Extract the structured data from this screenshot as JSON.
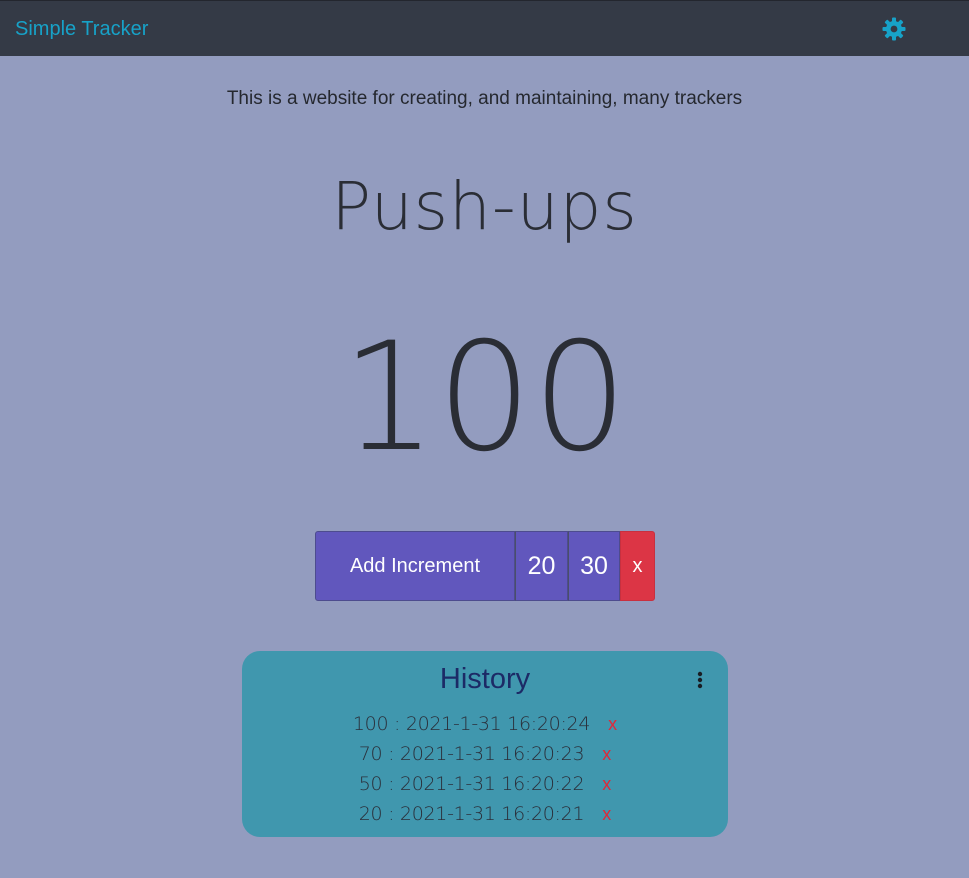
{
  "navbar": {
    "brand": "Simple Tracker",
    "settings_icon": "gear-icon",
    "brand_color": "#17a2c8",
    "background": "#343a46"
  },
  "tagline": "This is a website for creating, and maintaining, many trackers",
  "tracker": {
    "name": "Push-ups",
    "count": "100"
  },
  "controls": {
    "add_label": "Add Increment",
    "increments": [
      "20",
      "30"
    ],
    "remove_label": "x",
    "accent_color": "#6157bd",
    "danger_color": "#dc3545"
  },
  "history": {
    "title": "History",
    "menu_icon": "kebab-menu-icon",
    "background": "#4097ae",
    "entries": [
      {
        "text": "100 : 2021-1-31 16:20:24",
        "delete_label": "x"
      },
      {
        "text": "70 : 2021-1-31 16:20:23",
        "delete_label": "x"
      },
      {
        "text": "50 : 2021-1-31 16:20:22",
        "delete_label": "x"
      },
      {
        "text": "20 : 2021-1-31 16:20:21",
        "delete_label": "x"
      }
    ]
  },
  "page_background": "#939cbf"
}
